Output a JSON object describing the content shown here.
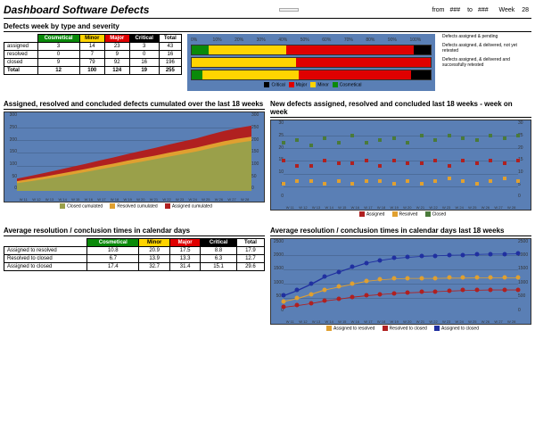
{
  "header": {
    "title": "Dashboard Software Defects",
    "button": "",
    "from": "from",
    "from_val": "###",
    "to": "to",
    "to_val": "###",
    "week_label": "Week",
    "week_val": "28"
  },
  "section1": {
    "title": "Defects week by type and severity",
    "cols": [
      "Cosmetical",
      "Minor",
      "Major",
      "Critical",
      "Total"
    ],
    "rows": [
      {
        "label": "assigned",
        "v": [
          3,
          14,
          23,
          3
        ],
        "total": 43
      },
      {
        "label": "resolved",
        "v": [
          0,
          7,
          9,
          0
        ],
        "total": 16
      },
      {
        "label": "closed",
        "v": [
          9,
          79,
          92,
          16
        ],
        "total": 196
      },
      {
        "label": "Total",
        "v": [
          12,
          100,
          124,
          19
        ],
        "total": 255
      }
    ],
    "side_labels": [
      "Defects assigned & pending",
      "Defects assigned, & delivered, not yet retested",
      "Defects assigned, & delivered and successfully retested"
    ],
    "legend": [
      "Critical",
      "Major",
      "Minor",
      "Cosmetical"
    ]
  },
  "section2L": {
    "title": "Assigned, resolved and concluded defects cumulated over the last 18 weeks",
    "legend": [
      "Closed cumulated",
      "Resolved cumulated",
      "Assigned cumulated"
    ]
  },
  "section2R": {
    "title": "New defects assigned, resolved and concluded last 18 weeks - week on week",
    "legend": [
      "Assigned",
      "Resolved",
      "Closed"
    ]
  },
  "section3L": {
    "title": "Average resolution / conclusion times in calendar days",
    "cols": [
      "Cosmetical",
      "Minor",
      "Major",
      "Critical",
      "Total"
    ],
    "rows": [
      {
        "label": "Assigned to resolved",
        "v": [
          10.8,
          20.9,
          17.5,
          8.8
        ],
        "total": 17.9
      },
      {
        "label": "Resolved to closed",
        "v": [
          6.7,
          13.9,
          13.3,
          6.3
        ],
        "total": 12.7
      },
      {
        "label": "Assigned to closed",
        "v": [
          17.4,
          32.7,
          31.4,
          15.1
        ],
        "total": 29.6
      }
    ]
  },
  "section3R": {
    "title": "Average resolution / conclusion times in calendar days last 18 weeks",
    "legend": [
      "Assigned to resolved",
      "Resolved to closed",
      "Assigned to closed"
    ]
  },
  "chart_data": [
    {
      "type": "bar",
      "orientation": "horizontal",
      "stacked": true,
      "categories": [
        "assigned",
        "resolved",
        "closed"
      ],
      "series": [
        {
          "name": "Cosmetical",
          "values": [
            3,
            0,
            9
          ],
          "color": "#0a8a0a"
        },
        {
          "name": "Minor",
          "values": [
            14,
            7,
            79
          ],
          "color": "#ffd400"
        },
        {
          "name": "Major",
          "values": [
            23,
            9,
            92
          ],
          "color": "#e00000"
        },
        {
          "name": "Critical",
          "values": [
            3,
            0,
            16
          ],
          "color": "#000000"
        }
      ],
      "xlabel": "%",
      "xlim": [
        0,
        100
      ],
      "xticks": [
        0,
        10,
        20,
        30,
        40,
        50,
        60,
        70,
        80,
        90,
        100
      ]
    },
    {
      "type": "area",
      "stacked": true,
      "x": [
        "W 11",
        "W 12",
        "W 13",
        "W 14",
        "W 15",
        "W 16",
        "W 17",
        "W 18",
        "W 19",
        "W 20",
        "W 21",
        "W 22",
        "W 23",
        "W 24",
        "W 25",
        "W 26",
        "W 27",
        "W 28"
      ],
      "series": [
        {
          "name": "Closed cumulated",
          "values": [
            30,
            38,
            46,
            55,
            64,
            74,
            84,
            94,
            104,
            114,
            124,
            134,
            144,
            154,
            166,
            178,
            188,
            196
          ],
          "color": "#9aa04a"
        },
        {
          "name": "Resolved cumulated",
          "values": [
            8,
            9,
            10,
            11,
            12,
            12,
            13,
            13,
            14,
            14,
            14,
            15,
            15,
            15,
            16,
            16,
            16,
            16
          ],
          "color": "#e0a030"
        },
        {
          "name": "Assigned cumulated",
          "values": [
            10,
            12,
            14,
            16,
            18,
            20,
            22,
            24,
            26,
            28,
            30,
            32,
            34,
            36,
            38,
            40,
            42,
            43
          ],
          "color": "#b02020"
        }
      ],
      "ylim_left": [
        0,
        300
      ],
      "ylim_right": [
        0,
        300
      ]
    },
    {
      "type": "scatter",
      "x": [
        "W 11",
        "W 12",
        "W 13",
        "W 14",
        "W 15",
        "W 16",
        "W 17",
        "W 18",
        "W 19",
        "W 20",
        "W 21",
        "W 22",
        "W 23",
        "W 24",
        "W 25",
        "W 26",
        "W 27",
        "W 28"
      ],
      "series": [
        {
          "name": "Assigned",
          "values": [
            15,
            13,
            13,
            15,
            14,
            14,
            15,
            13,
            15,
            14,
            14,
            15,
            13,
            15,
            14,
            15,
            14,
            15
          ],
          "color": "#b02020"
        },
        {
          "name": "Resolved",
          "values": [
            6,
            7,
            7,
            6,
            7,
            6,
            7,
            7,
            6,
            7,
            6,
            7,
            8,
            7,
            6,
            7,
            8,
            7
          ],
          "color": "#e0a030"
        },
        {
          "name": "Closed",
          "values": [
            22,
            23,
            21,
            24,
            22,
            25,
            22,
            23,
            24,
            22,
            25,
            23,
            25,
            24,
            23,
            25,
            24,
            25
          ],
          "color": "#4a7a3a"
        }
      ],
      "ylim_left": [
        0,
        30
      ],
      "ylim_right": [
        0,
        30
      ]
    },
    {
      "type": "line",
      "x": [
        "W 11",
        "W 12",
        "W 13",
        "W 14",
        "W 15",
        "W 16",
        "W 17",
        "W 18",
        "W 19",
        "W 20",
        "W 21",
        "W 22",
        "W 23",
        "W 24",
        "W 25",
        "W 26",
        "W 27",
        "W 28"
      ],
      "series": [
        {
          "name": "Assigned to resolved",
          "values": [
            400,
            500,
            650,
            800,
            900,
            1000,
            1100,
            1150,
            1180,
            1200,
            1200,
            1200,
            1210,
            1210,
            1220,
            1220,
            1220,
            1220
          ],
          "color": "#e0a030"
        },
        {
          "name": "Resolved to closed",
          "values": [
            200,
            260,
            330,
            420,
            480,
            550,
            600,
            640,
            680,
            700,
            720,
            740,
            760,
            780,
            790,
            800,
            800,
            800
          ],
          "color": "#b02020"
        },
        {
          "name": "Assigned to closed",
          "values": [
            600,
            780,
            1000,
            1250,
            1420,
            1580,
            1730,
            1820,
            1890,
            1930,
            1960,
            1980,
            2000,
            2010,
            2030,
            2040,
            2040,
            2050
          ],
          "color": "#2030a0"
        }
      ],
      "ylim_left": [
        0,
        2500
      ],
      "ylim_right": [
        0,
        2500
      ]
    }
  ]
}
